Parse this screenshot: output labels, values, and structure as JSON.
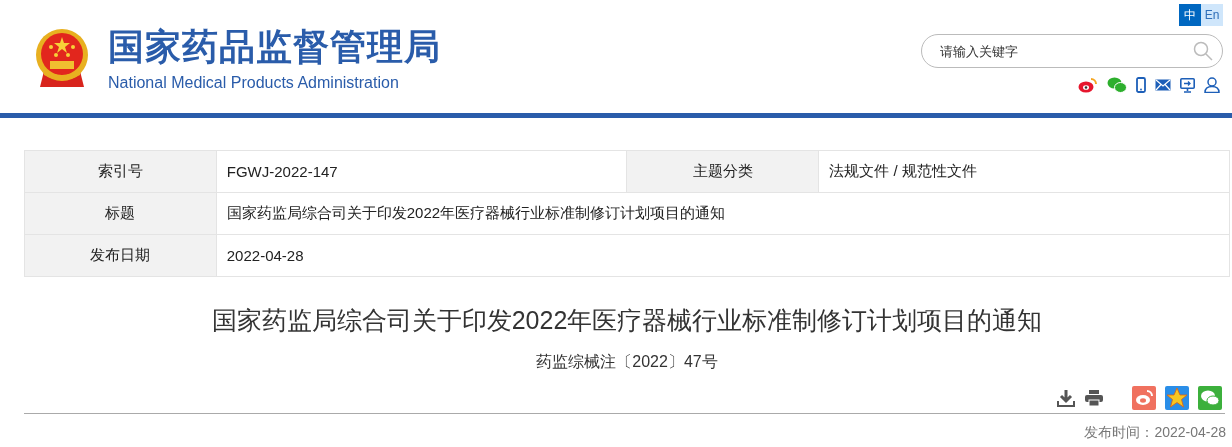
{
  "header": {
    "site_name": "国家药品监督管理局",
    "site_name_en": "National Medical Products Administration",
    "languages": [
      {
        "label": "中",
        "selected": true
      },
      {
        "label": "En",
        "selected": false
      }
    ],
    "search": {
      "placeholder": "请输入关键字"
    }
  },
  "info_table": {
    "rows": [
      {
        "cells": [
          {
            "label": "索引号",
            "value": "FGWJ-2022-147"
          },
          {
            "label": "主题分类",
            "value": "法规文件 / 规范性文件"
          }
        ]
      },
      {
        "cells": [
          {
            "label": "标题",
            "value": "国家药监局综合司关于印发2022年医疗器械行业标准制修订计划项目的通知"
          }
        ]
      },
      {
        "cells": [
          {
            "label": "发布日期",
            "value": "2022-04-28"
          }
        ]
      }
    ]
  },
  "article": {
    "title": "国家药监局综合司关于印发2022年医疗器械行业标准制修订计划项目的通知",
    "doc_number": "药监综械注〔2022〕47号",
    "publish_time": "发布时间：2022-04-28"
  }
}
